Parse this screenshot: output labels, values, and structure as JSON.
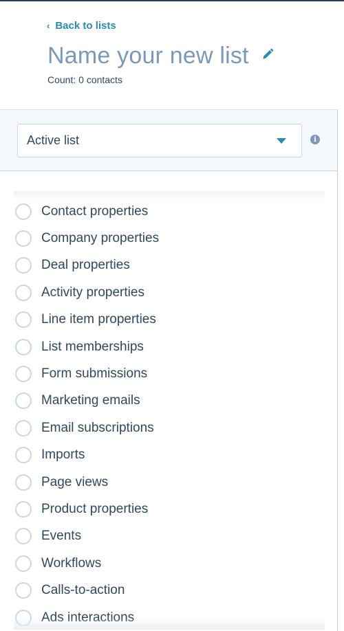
{
  "header": {
    "back_label": "Back to lists",
    "back_icon": "chevron-left-icon",
    "title": "Name your new list",
    "edit_icon": "pencil-icon",
    "count_text": "Count: 0 contacts"
  },
  "filter": {
    "list_type": {
      "selected": "Active list",
      "icon": "caret-down-icon"
    },
    "info_icon": "info-icon",
    "info_glyph": "i"
  },
  "filter_categories": {
    "items": [
      {
        "label": "Contact properties"
      },
      {
        "label": "Company properties"
      },
      {
        "label": "Deal properties"
      },
      {
        "label": "Activity properties"
      },
      {
        "label": "Line item properties"
      },
      {
        "label": "List memberships"
      },
      {
        "label": "Form submissions"
      },
      {
        "label": "Marketing emails"
      },
      {
        "label": "Email subscriptions"
      },
      {
        "label": "Imports"
      },
      {
        "label": "Page views"
      },
      {
        "label": "Product properties"
      },
      {
        "label": "Events"
      },
      {
        "label": "Workflows"
      },
      {
        "label": "Calls-to-action"
      },
      {
        "label": "Ads interactions"
      }
    ]
  },
  "colors": {
    "accent": "#2d8aa8",
    "title": "#7c98b6",
    "text": "#33475b",
    "panel_bg": "#f5f8fa",
    "border": "#cbd6e2"
  }
}
